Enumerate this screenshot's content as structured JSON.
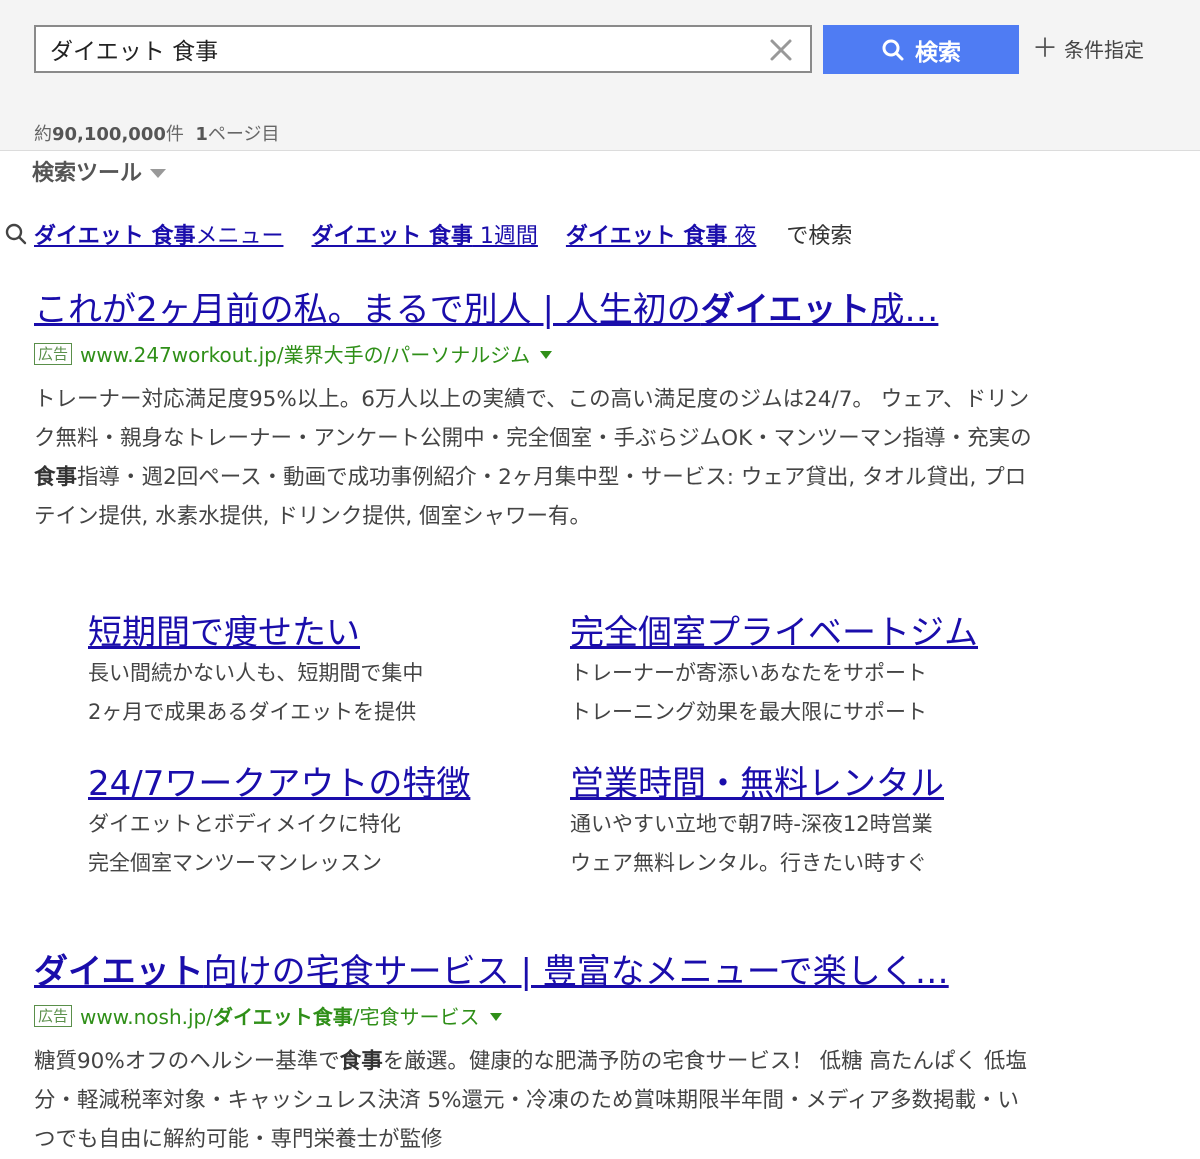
{
  "search": {
    "query": "ダイエット 食事",
    "button_label": "検索",
    "options_label": "条件指定"
  },
  "stats": {
    "count_prefix": "約",
    "count": "90,100,000",
    "count_suffix": "件",
    "page_number": "1",
    "page_suffix": "ページ目"
  },
  "tools": {
    "label": "検索ツール"
  },
  "related": {
    "items": [
      {
        "bold": "ダイエット 食事",
        "rest": "メニュー"
      },
      {
        "bold": "ダイエット 食事",
        "rest": " 1週間"
      },
      {
        "bold": "ダイエット 食事",
        "rest": " 夜"
      }
    ],
    "suffix": "で検索"
  },
  "ads": [
    {
      "title_a": "これが2ヶ月前の私。まるで別人 | 人生初の",
      "title_b": "ダイエット",
      "title_c": "成…",
      "badge": "広告",
      "url_a": "www.247workout.jp/業界大手の/パーソナルジム",
      "desc_a": "トレーナー対応満足度95%以上。6万人以上の実績で、この高い満足度のジムは24/7。 ウェア、ドリンク無料・親身なトレーナー・アンケート公開中・完全個室・手ぶらジムOK・マンツーマン指導・充実の",
      "desc_b": "食事",
      "desc_c": "指導・週2回ペース・動画で成功事例紹介・2ヶ月集中型・サービス: ウェア貸出, タオル貸出, プロテイン提供, 水素水提供, ドリンク提供, 個室シャワー有。",
      "sitelinks": [
        {
          "title": "短期間で痩せたい",
          "line1": "長い間続かない人も、短期間で集中",
          "line2": "2ヶ月で成果あるダイエットを提供"
        },
        {
          "title": "完全個室プライベートジム",
          "line1": "トレーナーが寄添いあなたをサポート",
          "line2": "トレーニング効果を最大限にサポート"
        },
        {
          "title": "24/7ワークアウトの特徴",
          "line1": "ダイエットとボディメイクに特化",
          "line2": "完全個室マンツーマンレッスン"
        },
        {
          "title": "営業時間・無料レンタル",
          "line1": "通いやすい立地で朝7時-深夜12時営業",
          "line2": "ウェア無料レンタル。行きたい時すぐ"
        }
      ]
    },
    {
      "title_a": "ダイエット",
      "title_b": "向けの宅食サービス | 豊富なメニューで楽しく…",
      "badge": "広告",
      "url_a": "www.nosh.jp/",
      "url_b": "ダイエット食事",
      "url_c": "/宅食サービス",
      "desc_a": "糖質90%オフのヘルシー基準で",
      "desc_b": "食事",
      "desc_c": "を厳選。健康的な肥満予防の宅食サービス！ 低糖 高たんぱく 低塩分・軽減税率対象・キャッシュレス決済 5%還元・冷凍のため賞味期限半年間・メディア多数掲載・いつでも自由に解約可能・専門栄養士が監修"
    }
  ],
  "colors": {
    "link": "#1a0dab",
    "url_green": "#2f8f18",
    "button_blue": "#4f7cf3",
    "header_bg": "#f4f4f4"
  },
  "icons": {
    "clear": "close-icon",
    "search": "search-icon",
    "options": "plus-icon",
    "tools": "triangle-down-icon",
    "related": "magnifier-icon"
  }
}
